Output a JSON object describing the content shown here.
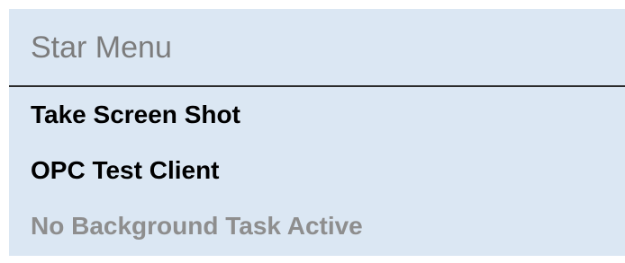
{
  "menu": {
    "title": "Star Menu",
    "items": [
      {
        "label": "Take Screen Shot",
        "enabled": true
      },
      {
        "label": "OPC Test Client",
        "enabled": true
      },
      {
        "label": "No Background Task Active",
        "enabled": false
      }
    ]
  },
  "colors": {
    "panel_background": "#dbe7f3",
    "title_text": "#7c7c7c",
    "enabled_text": "#000000",
    "disabled_text": "#8e8e8e",
    "divider": "#2b2b2b"
  }
}
